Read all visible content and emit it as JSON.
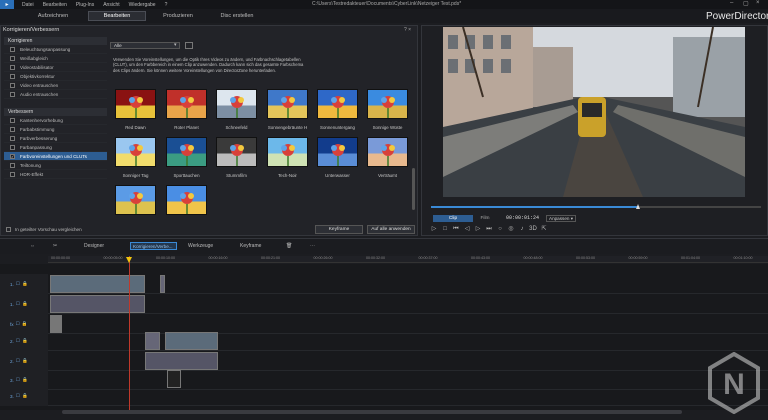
{
  "menubar": {
    "items": [
      "Datei",
      "Bearbeiten",
      "Plug-Ins",
      "Ansicht",
      "Wiedergabe",
      "?"
    ],
    "path": "C:\\Users\\Testredakteuer\\Documents\\CyberLink\\Netzeiger Test.pds*"
  },
  "mode_tabs": [
    "Aufzeichnen",
    "Bearbeiten",
    "Produzieren",
    "Disc erstellen"
  ],
  "brand": "PowerDirector",
  "panel": {
    "title": "Korrigieren/Verbessern",
    "close": "?  ×"
  },
  "groups": {
    "korrigieren": {
      "label": "Korrigieren",
      "items": [
        "Beleuchtungsanpassung",
        "Weißabgleich",
        "Videostabilisator",
        "Objektivkorrektur",
        "Video entrauschen",
        "Audio entrauschen"
      ]
    },
    "verbessern": {
      "label": "Verbessern",
      "items": [
        "Kantenhervorhebung",
        "Farbabstimmung",
        "Farbverbesserung",
        "Farbanpassung",
        "Farbvoreinstellungen und CLUTs",
        "Teiltonung",
        "HDR-Effekt"
      ]
    }
  },
  "filter": {
    "value": "Alle"
  },
  "description": "Verwenden Sie Voreinstellungen, um die Optik Ihres Videos zu ändern, und Farbnachschlagetabellen (CLUT), um den Farbbereich in einem Clip anzuwenden. Dadurch kann sich das gesamte Farbschema des Clips ändern. Sie können weitere Voreinstellungen von DirectorZone herunterladen.",
  "presets": [
    {
      "label": "Red Dawn",
      "c1": "#8a1212",
      "c2": "#e8c23a"
    },
    {
      "label": "Roter Planet",
      "c1": "#c0302a",
      "c2": "#e9a449"
    },
    {
      "label": "Schneefeld",
      "c1": "#dde6ee",
      "c2": "#7d8fa3"
    },
    {
      "label": "Sonnengebräunte H",
      "c1": "#3f78c9",
      "c2": "#e4c55a"
    },
    {
      "label": "Sonnenuntergang",
      "c1": "#2e68c8",
      "c2": "#f0b93e"
    },
    {
      "label": "Sonnige Wüste",
      "c1": "#3a8be0",
      "c2": "#d9b44a"
    },
    {
      "label": "Sonniger Tag",
      "c1": "#9ac7f0",
      "c2": "#f1dc6c"
    },
    {
      "label": "Sporttauchen",
      "c1": "#1a4f94",
      "c2": "#3b9c82"
    },
    {
      "label": "Stummfilm",
      "c1": "#3a3a3a",
      "c2": "#bcbcbc"
    },
    {
      "label": "Tech-Noir",
      "c1": "#6cb8ea",
      "c2": "#cfe2b4"
    },
    {
      "label": "Unterwasser",
      "c1": "#123c8c",
      "c2": "#5a8dd6"
    },
    {
      "label": "Verträumt",
      "c1": "#7a9ad8",
      "c2": "#e8b98e"
    },
    {
      "label": "",
      "c1": "#5b9be6",
      "c2": "#ddc24e"
    },
    {
      "label": "",
      "c1": "#4a8ee4",
      "c2": "#f0c44a"
    }
  ],
  "preview_checkbox": "In geteilter Vorschau vergleichen",
  "buttons": {
    "keyframe": "Keyframe",
    "apply_all": "Auf alle anwenden"
  },
  "player": {
    "clip": "Clip",
    "film": "Film",
    "timecode": "00:00:01:24",
    "fit": "Anpassen ▾",
    "progress": 0.63
  },
  "timeline_toolbar": {
    "designer": "Designer",
    "mode": "Korrigieren/Verbe...",
    "workouts": "Werkzeuge",
    "keyframe": "Keyframe"
  },
  "ruler_ticks": [
    "00:00:00:00",
    "00:00:05:00",
    "00:00:10:00",
    "00:00:16:00",
    "00:00:21:00",
    "00:00:26:00",
    "00:00:32:00",
    "00:00:37:00",
    "00:00:43:00",
    "00:00:48:00",
    "00:00:53:00",
    "00:00:59:00",
    "00:01:04:00",
    "00:01:10:00",
    "00:01:15:00"
  ],
  "tracks": [
    "1.",
    "1.",
    "fx",
    "2.",
    "2.",
    "3.",
    "3."
  ]
}
